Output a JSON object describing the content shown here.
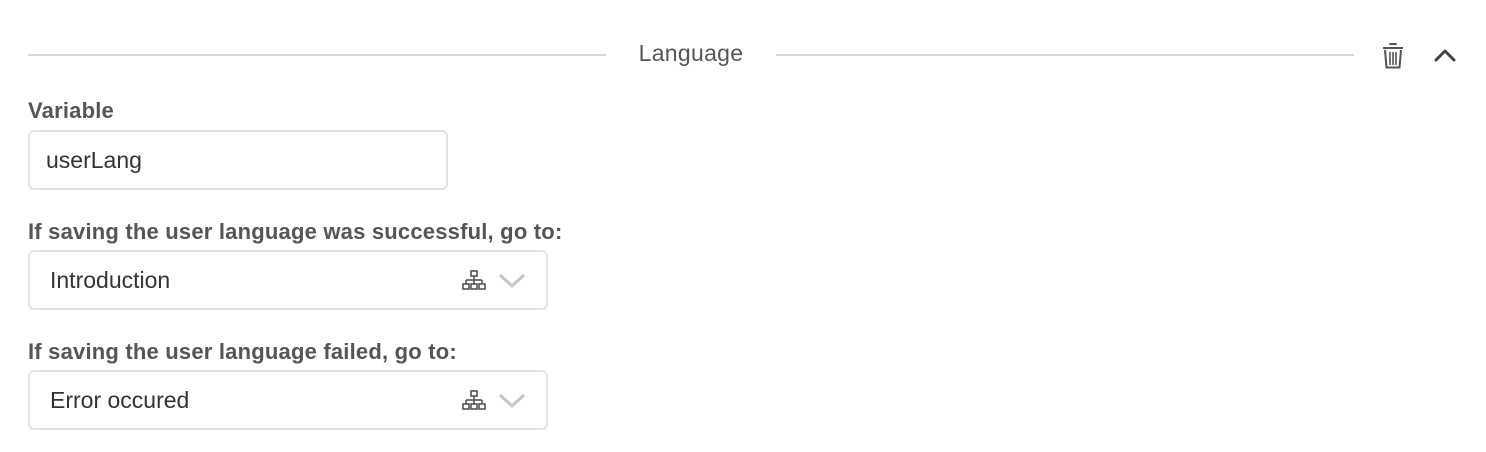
{
  "section": {
    "title": "Language",
    "delete_icon": "trash-icon",
    "collapse_icon": "chevron-up-icon"
  },
  "variable": {
    "label": "Variable",
    "value": "userLang"
  },
  "success": {
    "label": "If saving the user language was successful, go to:",
    "selected": "Introduction",
    "tree_icon": "sitemap-icon",
    "dropdown_icon": "chevron-down-icon"
  },
  "failure": {
    "label": "If saving the user language failed, go to:",
    "selected": "Error occured",
    "tree_icon": "sitemap-icon",
    "dropdown_icon": "chevron-down-icon"
  },
  "colors": {
    "text": "#555555",
    "border": "#e2e2e2",
    "divider": "#d9d9d9",
    "icon_muted": "#c8c8c8"
  }
}
